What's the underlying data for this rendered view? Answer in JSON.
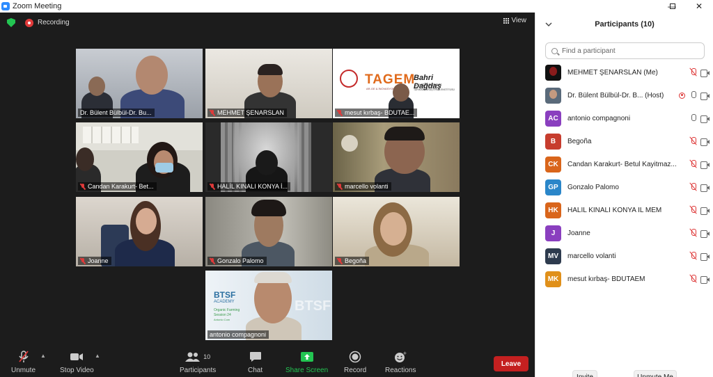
{
  "window": {
    "title": "Zoom Meeting",
    "minimize": "—",
    "maximize": "❐",
    "close": "✕"
  },
  "meeting": {
    "recording_label": "Recording",
    "view_label": "View"
  },
  "tiles": [
    {
      "name": "Dr. Bülent Bülbül-Dr. Bu...",
      "muted": false,
      "active": true
    },
    {
      "name": "MEHMET ŞENARSLAN",
      "muted": true
    },
    {
      "name": "mesut kırbaş- BDUTAE...",
      "muted": true
    },
    {
      "name": "Candan Karakurt- Bet...",
      "muted": true
    },
    {
      "name": "HALİL KINALI KONYA İ...",
      "muted": true
    },
    {
      "name": "marcello volanti",
      "muted": true
    },
    {
      "name": "Joanne",
      "muted": true
    },
    {
      "name": "Gonzalo Palomo",
      "muted": true
    },
    {
      "name": "Begoña",
      "muted": true
    },
    {
      "name": "antonio compagnoni",
      "muted": false
    }
  ],
  "tile_overlays": {
    "tagem_logo": "TAGEM",
    "tagem_sub": "AR-GE & İNOVASYON",
    "bahri_title": "Bahri Dağdaş",
    "bahri_sub1": "ULUSLARARASI",
    "bahri_sub2": "TARIMSAL ARAŞTIRMA ENSTİTÜSÜ",
    "btsf_line1": "BTSF",
    "btsf_line2": "ACADEMY",
    "btsf_line3": "Organic Farming",
    "btsf_line4": "Session 24",
    "btsf_line5": "Antonio Com",
    "btsf_bg": "BTSF"
  },
  "toolbar": {
    "unmute_label": "Unmute",
    "stop_video_label": "Stop Video",
    "participants_label": "Participants",
    "participants_count": "10",
    "chat_label": "Chat",
    "share_screen_label": "Share Screen",
    "record_label": "Record",
    "reactions_label": "Reactions",
    "leave_label": "Leave"
  },
  "panel": {
    "title": "Participants (10)",
    "search_placeholder": "Find a participant",
    "invite_label": "Invite",
    "unmute_me_label": "Unmute Me",
    "participants": [
      {
        "initials": "",
        "name": "MEHMET ŞENARSLAN (Me)",
        "color": "#111111",
        "mic": "muted",
        "photo": true
      },
      {
        "initials": "",
        "name": "Dr. Bülent Bülbül-Dr. B... (Host)",
        "color": "#5a6a7a",
        "mic": "on",
        "recording": true,
        "photo": true
      },
      {
        "initials": "AC",
        "name": "antonio compagnoni",
        "color": "#8a3fbf",
        "mic": "on"
      },
      {
        "initials": "B",
        "name": "Begoña",
        "color": "#c73d2e",
        "mic": "muted"
      },
      {
        "initials": "CK",
        "name": "Candan Karakurt- Betul Kayitmaz...",
        "color": "#d9651b",
        "mic": "muted"
      },
      {
        "initials": "GP",
        "name": "Gonzalo Palomo",
        "color": "#2a86c9",
        "mic": "muted"
      },
      {
        "initials": "HK",
        "name": "HALİL KINALI KONYA İL MEM",
        "color": "#d9651b",
        "mic": "muted"
      },
      {
        "initials": "J",
        "name": "Joanne",
        "color": "#8a3fbf",
        "mic": "muted"
      },
      {
        "initials": "MV",
        "name": "marcello volanti",
        "color": "#2e3b4e",
        "mic": "muted"
      },
      {
        "initials": "MK",
        "name": "mesut kırbaş- BDUTAEM",
        "color": "#e0901a",
        "mic": "muted"
      }
    ]
  }
}
